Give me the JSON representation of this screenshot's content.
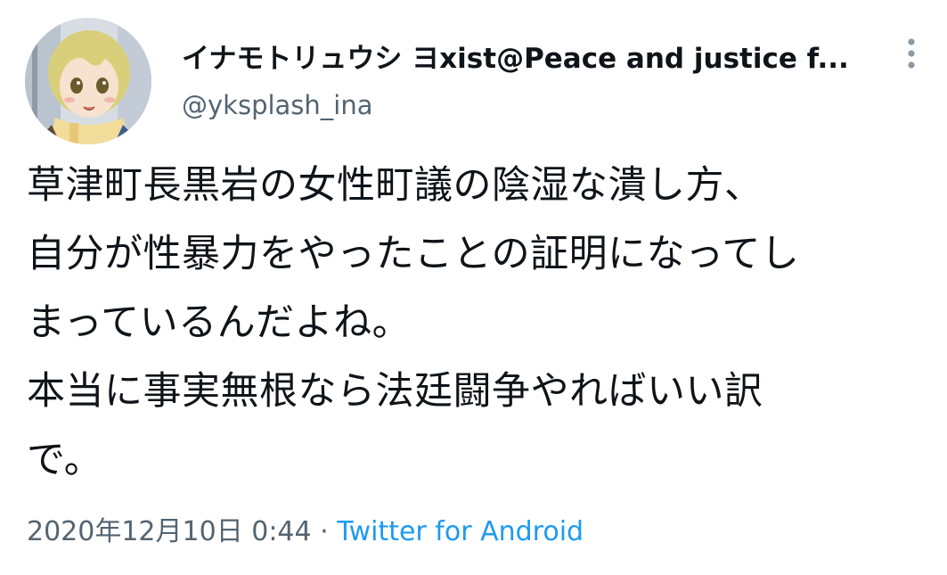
{
  "author": {
    "display_name": "イナモトリュウシ ヨxist@Peace and justice f...",
    "handle": "@yksplash_ina"
  },
  "tweet": {
    "lines": [
      "草津町長黒岩の女性町議の陰湿な潰し方、",
      "自分が性暴力をやったことの証明になってし",
      "まっているんだよね。",
      "本当に事実無根なら法廷闘争やればいい訳",
      "で。"
    ]
  },
  "meta": {
    "timestamp": "2020年12月10日 0:44",
    "separator": " · ",
    "source": "Twitter for Android"
  },
  "icons": {
    "more": "more-vertical-icon",
    "avatar": "avatar"
  },
  "colors": {
    "text": "#0f1419",
    "secondary": "#536471",
    "link": "#1d9bf0"
  }
}
